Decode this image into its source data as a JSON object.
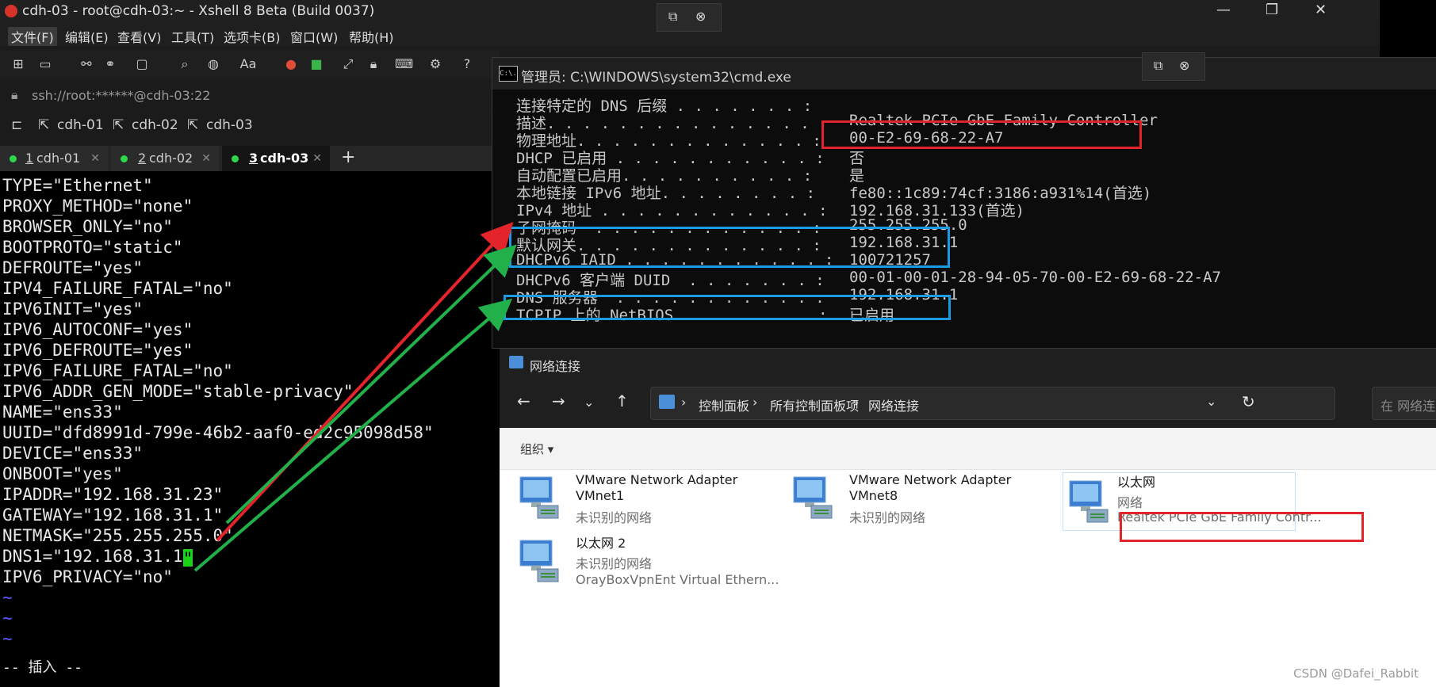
{
  "xshell": {
    "title": "cdh-03 - root@cdh-03:~ - Xshell 8 Beta (Build 0037)",
    "menu": [
      "文件(F)",
      "编辑(E)",
      "查看(V)",
      "工具(T)",
      "选项卡(B)",
      "窗口(W)",
      "帮助(H)"
    ],
    "address": "ssh://root:******@cdh-03:22",
    "links": [
      "cdh-01",
      "cdh-02",
      "cdh-03"
    ],
    "tabs": [
      {
        "num": "1",
        "label": "cdh-01"
      },
      {
        "num": "2",
        "label": "cdh-02"
      },
      {
        "num": "3",
        "label": "cdh-03"
      }
    ],
    "tab_add": "+",
    "terminal_lines": [
      "TYPE=\"Ethernet\"",
      "PROXY_METHOD=\"none\"",
      "BROWSER_ONLY=\"no\"",
      "BOOTPROTO=\"static\"",
      "DEFROUTE=\"yes\"",
      "IPV4_FAILURE_FATAL=\"no\"",
      "IPV6INIT=\"yes\"",
      "IPV6_AUTOCONF=\"yes\"",
      "IPV6_DEFROUTE=\"yes\"",
      "IPV6_FAILURE_FATAL=\"no\"",
      "IPV6_ADDR_GEN_MODE=\"stable-privacy\"",
      "NAME=\"ens33\"",
      "UUID=\"dfd8991d-799e-46b2-aaf0-ed2c95098d58\"",
      "DEVICE=\"ens33\"",
      "ONBOOT=\"yes\"",
      "IPADDR=\"192.168.31.23\"",
      "GATEWAY=\"192.168.31.1\"",
      "NETMASK=\"255.255.255.0\"",
      "DNS1=\"192.168.31.1",
      "IPV6_PRIVACY=\"no\"",
      "~",
      "~",
      "~",
      "-- 插入 --"
    ],
    "cursor_char": "\""
  },
  "cmd": {
    "title": "管理员: C:\\WINDOWS\\system32\\cmd.exe",
    "icon_text": "C:\\.",
    "rows": [
      {
        "label": "连接特定的 DNS 后缀 . . . . . . . :",
        "value": ""
      },
      {
        "label": "描述. . . . . . . . . . . . . . . :",
        "value": "Realtek PCIe GbE Family Controller"
      },
      {
        "label": "物理地址. . . . . . . . . . . . . :",
        "value": "00-E2-69-68-22-A7"
      },
      {
        "label": "DHCP 已启用 . . . . . . . . . . . :",
        "value": "否"
      },
      {
        "label": "自动配置已启用. . . . . . . . . . :",
        "value": "是"
      },
      {
        "label": "本地链接 IPv6 地址. . . . . . . . :",
        "value": "fe80::1c89:74cf:3186:a931%14(首选)"
      },
      {
        "label": "IPv4 地址 . . . . . . . . . . . . :",
        "value": "192.168.31.133(首选)"
      },
      {
        "label": "子网掩码  . . . . . . . . . . . . :",
        "value": "255.255.255.0"
      },
      {
        "label": "默认网关. . . . . . . . . . . . . :",
        "value": "192.168.31.1"
      },
      {
        "label": "DHCPv6 IAID . . . . . . . . . . . :",
        "value": "100721257"
      },
      {
        "label": "DHCPv6 客户端 DUID  . . . . . . . :",
        "value": "00-01-00-01-28-94-05-70-00-E2-69-68-22-A7"
      },
      {
        "label": "DNS 服务器  . . . . . . . . . . . :",
        "value": "192.168.31.1"
      },
      {
        "label": "TCPIP 上的 NetBIOS  . . . . . . . :",
        "value": "已启用"
      }
    ]
  },
  "network": {
    "title": "网络连接",
    "breadcrumb": [
      "控制面板",
      "所有控制面板项",
      "网络连接"
    ],
    "search_placeholder": "在 网络连",
    "organize": "组织",
    "adapters": [
      {
        "name": "VMware Network Adapter VMnet1",
        "status": "未识别的网络",
        "device": ""
      },
      {
        "name": "VMware Network Adapter VMnet8",
        "status": "未识别的网络",
        "device": ""
      },
      {
        "name": "以太网",
        "status": "网络",
        "device": "Realtek PCIe GbE Family Contr..."
      },
      {
        "name": "以太网 2",
        "status": "未识别的网络",
        "device": "OrayBoxVpnEnt Virtual Ethern..."
      }
    ]
  },
  "watermark": "CSDN @Dafei_Rabbit",
  "colors": {
    "red_box": "#e3242b",
    "blue_box": "#1a9be3",
    "arrow_red": "#e3242b",
    "arrow_green": "#22b04a",
    "cursor": "#19d219"
  }
}
